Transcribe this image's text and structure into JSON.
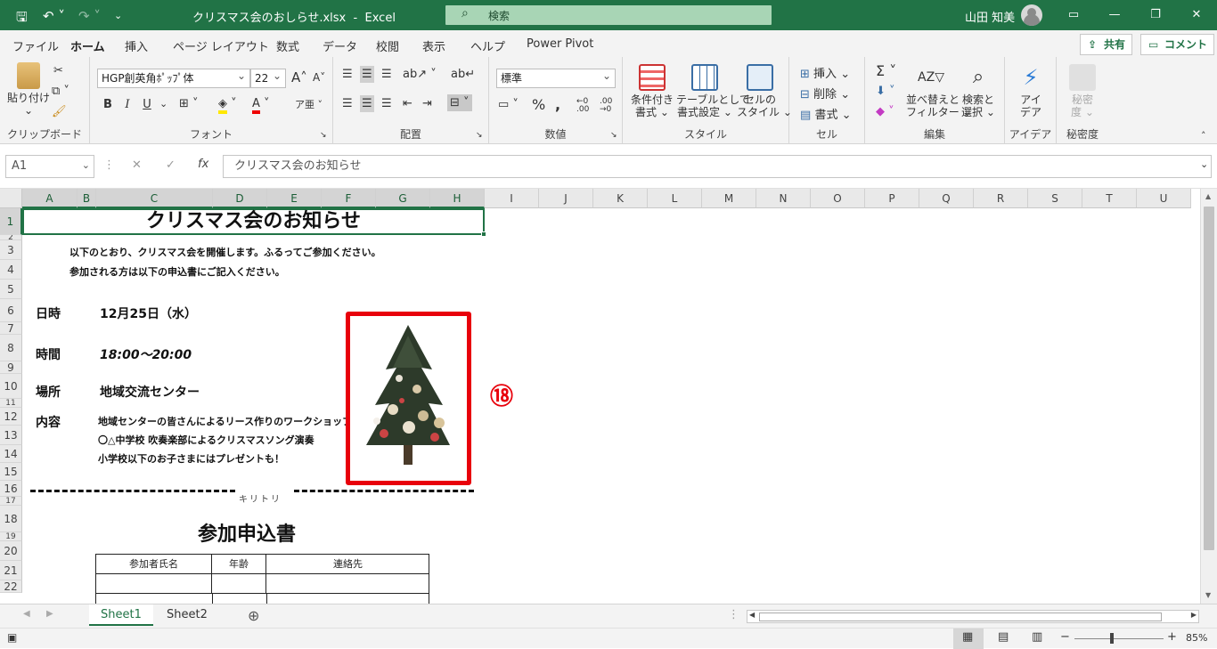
{
  "titlebar": {
    "filename": "クリスマス会のおしらせ.xlsx",
    "app": "Excel",
    "search_placeholder": "検索",
    "user": "山田 知美"
  },
  "menu": {
    "tabs": [
      "ファイル",
      "ホーム",
      "挿入",
      "ページ レイアウト",
      "数式",
      "データ",
      "校閲",
      "表示",
      "ヘルプ",
      "Power Pivot"
    ],
    "active": "ホーム",
    "share": "共有",
    "comment": "コメント"
  },
  "ribbon": {
    "clipboard": {
      "paste": "貼り付け",
      "label": "クリップボード"
    },
    "font": {
      "name": "HGP創英角ﾎﾟｯﾌﾟ体",
      "size": "22",
      "bold": "B",
      "italic": "I",
      "underline": "U",
      "label": "フォント"
    },
    "alignment": {
      "label": "配置"
    },
    "number": {
      "format": "標準",
      "label": "数値"
    },
    "styles": {
      "conditional": [
        "条件付き",
        "書式"
      ],
      "table": [
        "テーブルとして",
        "書式設定"
      ],
      "cell": [
        "セルの",
        "スタイル"
      ],
      "label": "スタイル"
    },
    "cells": {
      "insert": "挿入",
      "delete": "削除",
      "format": "書式",
      "label": "セル"
    },
    "editing": {
      "sort": [
        "並べ替えと",
        "フィルター"
      ],
      "find": [
        "検索と",
        "選択"
      ],
      "label": "編集"
    },
    "ideas": {
      "btn": [
        "アイ",
        "デア"
      ],
      "label": "アイデア"
    },
    "sensitivity": {
      "btn": [
        "秘密",
        "度"
      ],
      "label": "秘密度"
    }
  },
  "formula_bar": {
    "name_box": "A1",
    "content": "クリスマス会のお知らせ"
  },
  "columns": [
    "A",
    "B",
    "C",
    "D",
    "E",
    "F",
    "G",
    "H",
    "I",
    "J",
    "K",
    "L",
    "M",
    "N",
    "O",
    "P",
    "Q",
    "R",
    "S",
    "T",
    "U"
  ],
  "rows": [
    "1",
    "2",
    "3",
    "4",
    "5",
    "6",
    "7",
    "8",
    "9",
    "10",
    "11",
    "12",
    "13",
    "14",
    "15",
    "16",
    "17",
    "18",
    "19",
    "20",
    "21",
    "22"
  ],
  "sheet": {
    "title": "クリスマス会のお知らせ",
    "intro1": "以下のとおり、クリスマス会を開催します。ふるってご参加ください。",
    "intro2": "参加される方は以下の申込書にご記入ください。",
    "date_label": "日時",
    "date_value": "12月25日（水）",
    "time_label": "時間",
    "time_value": "18:00～20:00",
    "place_label": "場所",
    "place_value": "地域交流センター",
    "content_label": "内容",
    "content1": "地域センターの皆さんによるリース作りのワークショップ",
    "content2": "〇△中学校 吹奏楽部によるクリスマスソング演奏",
    "content3": "小学校以下のお子さまにはプレゼントも！",
    "cut_text": "キリトリ",
    "form_title": "参加申込書",
    "form_headers": [
      "参加者氏名",
      "年齢",
      "連絡先"
    ],
    "annotation": "⑱"
  },
  "sheet_tabs": [
    "Sheet1",
    "Sheet2"
  ],
  "active_sheet": "Sheet1",
  "status": {
    "zoom": "85%"
  },
  "colors": {
    "excel_green": "#217346",
    "highlight_red": "#e8000b"
  }
}
